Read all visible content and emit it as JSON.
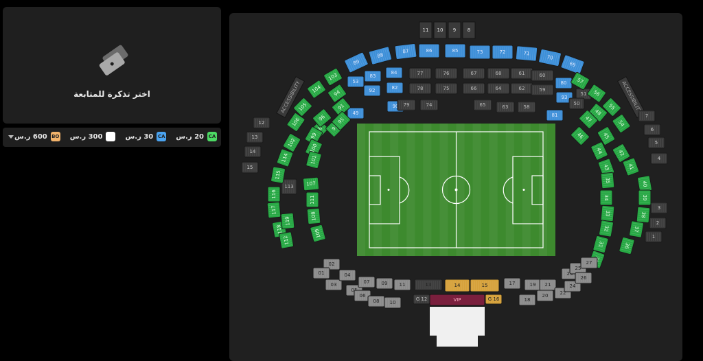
{
  "prompt": {
    "text": "اختر تذكرة للمتابعة"
  },
  "legend": [
    {
      "code": "CA",
      "price": "20 ر.س",
      "color": "#4cd964"
    },
    {
      "code": "CA",
      "price": "30 ر.س",
      "color": "#4aa3f0"
    },
    {
      "code": "",
      "price": "300 ر.س",
      "color": "#ffffff"
    },
    {
      "code": "BO",
      "price": "600 ر.س",
      "color": "#f2b36b"
    }
  ],
  "map": {
    "colors": {
      "green": "#27a844",
      "blue": "#3d8fd8",
      "dark": "#3a3a3a",
      "gray": "#8a8a8a",
      "gold": "#d6a13a",
      "vip": "#7a1f3d",
      "pitch": "#3d8a2e"
    },
    "top_boxes": [
      "11",
      "10",
      "9",
      "8"
    ],
    "vip_label": "VIP",
    "accessibility_label": "ACCESSIBILITY",
    "sections": {
      "blue": [
        "89",
        "88",
        "87",
        "86",
        "85",
        "73",
        "72",
        "71",
        "70",
        "69",
        "83",
        "84",
        "92",
        "82",
        "80",
        "93",
        "81",
        "90",
        "53",
        "52",
        "49"
      ],
      "dark": [
        "77",
        "76",
        "67",
        "68",
        "61",
        "60",
        "78",
        "75",
        "66",
        "64",
        "62",
        "59",
        "79",
        "74",
        "65",
        "63",
        "58",
        "51",
        "50",
        "113"
      ],
      "green": [
        "103",
        "104",
        "94",
        "91",
        "105",
        "106",
        "98",
        "97",
        "95",
        "96",
        "107",
        "99",
        "100",
        "101",
        "102",
        "114",
        "115",
        "116",
        "117",
        "118",
        "119",
        "112",
        "111",
        "108",
        "109",
        "110",
        "57",
        "56",
        "55",
        "54",
        "48",
        "47",
        "46",
        "45",
        "44",
        "43",
        "42",
        "41",
        "40",
        "39",
        "38",
        "37",
        "36",
        "35",
        "34",
        "33",
        "32",
        "31",
        "30",
        "29",
        "28"
      ],
      "left_dark": [
        "12",
        "13",
        "14",
        "15"
      ],
      "right_dark": [
        "7",
        "6",
        "5",
        "4",
        "3",
        "2",
        "1"
      ],
      "lower_gray": [
        "02",
        "01",
        "03",
        "04",
        "05",
        "06",
        "07",
        "08",
        "09",
        "10",
        "11",
        "13",
        "17",
        "18",
        "19",
        "20",
        "21",
        "22",
        "23",
        "24",
        "25",
        "26",
        "27"
      ],
      "gold": [
        "14",
        "15",
        "G 16"
      ],
      "g12": "G 12"
    }
  }
}
